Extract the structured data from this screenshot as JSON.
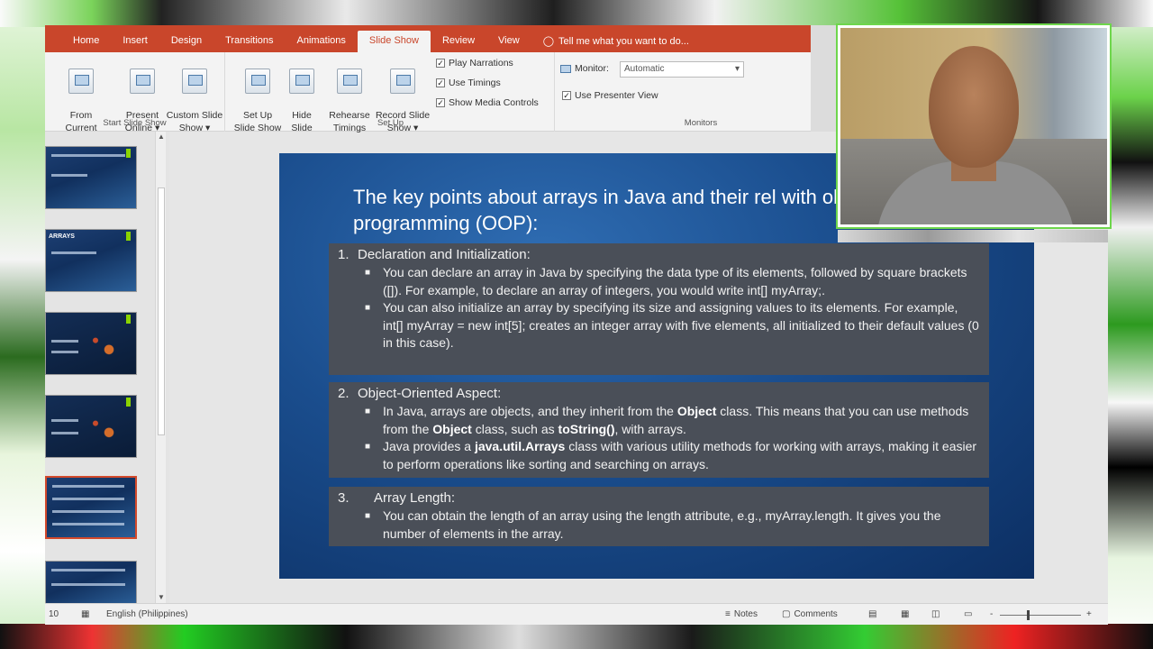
{
  "ribbon": {
    "tabs": [
      "Home",
      "Insert",
      "Design",
      "Transitions",
      "Animations",
      "Slide Show",
      "Review",
      "View"
    ],
    "active_tab": "Slide Show",
    "tell_me": "Tell me what you want to do...",
    "groups": {
      "start": {
        "label": "Start Slide Show",
        "from_current": "From\nCurrent Slide",
        "present_online": "Present\nOnline ▾",
        "custom": "Custom Slide\nShow ▾"
      },
      "setup": {
        "label": "Set Up",
        "set_up": "Set Up\nSlide Show",
        "hide": "Hide\nSlide",
        "rehearse": "Rehearse\nTimings",
        "record": "Record Slide\nShow ▾",
        "play_narrations": "Play Narrations",
        "use_timings": "Use Timings",
        "show_media": "Show Media Controls"
      },
      "monitors": {
        "label": "Monitors",
        "monitor_label": "Monitor:",
        "monitor_value": "Automatic",
        "presenter_view": "Use Presenter View"
      }
    }
  },
  "thumbs": {
    "t2_label": "ARRAYS"
  },
  "slide": {
    "title": "The key points about arrays in Java and their rel with object-oriented programming (OOP):",
    "sections": [
      {
        "num": "1.",
        "heading": "Declaration and Initialization:",
        "bullets": [
          "You can declare an array in Java by specifying the data type of its elements, followed by square brackets ([]). For example, to declare an array of integers, you would write int[] myArray;.",
          "You can also initialize an array by specifying its size and assigning values to its elements. For example, int[] myArray = new int[5]; creates an integer array with five elements, all initialized to their default values (0 in this case)."
        ]
      },
      {
        "num": "2.",
        "heading": "Object-Oriented Aspect:",
        "b1_pre": "In Java, arrays are objects, and they inherit from the ",
        "b1_bold1": "Object",
        "b1_mid": " class. This means that you can use methods from the ",
        "b1_bold2": "Object",
        "b1_mid2": " class, such as ",
        "b1_bold3": "toString()",
        "b1_post": ", with arrays.",
        "b2_pre": "Java provides a ",
        "b2_bold": "java.util.Arrays",
        "b2_post": " class with various utility methods for working with arrays, making it easier to perform operations like sorting and searching on arrays."
      },
      {
        "num": "3.",
        "heading": "Array Length:",
        "bullets": [
          "You can obtain the length of an array using the length attribute, e.g., myArray.length. It gives you the number of elements in the array."
        ]
      }
    ]
  },
  "status": {
    "slide_num": "10",
    "language": "English (Philippines)",
    "notes": "Notes",
    "comments": "Comments",
    "minus": "-",
    "plus": "+"
  }
}
